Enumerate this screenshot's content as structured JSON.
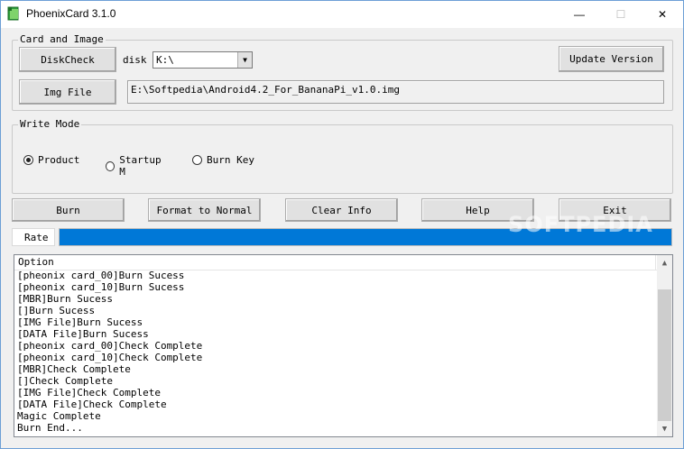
{
  "window": {
    "title": "PhoenixCard 3.1.0",
    "minimize_glyph": "—",
    "maximize_glyph": "☐",
    "close_glyph": "✕"
  },
  "card_image": {
    "group_label": "Card and Image",
    "diskcheck_label": "DiskCheck",
    "disk_label": "disk",
    "disk_value": "K:\\",
    "update_label": "Update Version",
    "imgfile_label": "Img File",
    "img_path": "E:\\Softpedia\\Android4.2_For_BananaPi_v1.0.img"
  },
  "write_mode": {
    "group_label": "Write Mode",
    "options": [
      {
        "label": "Product",
        "selected": true
      },
      {
        "label": "Startup M",
        "selected": false
      },
      {
        "label": "Burn Key",
        "selected": false
      }
    ]
  },
  "actions": {
    "burn": "Burn",
    "format": "Format to Normal",
    "clear": "Clear Info",
    "help": "Help",
    "exit": "Exit"
  },
  "rate": {
    "label": "Rate",
    "progress": 1.0,
    "color": "#0078d7"
  },
  "watermark": "SOFTPEDIA",
  "log": {
    "header": "Option",
    "rows": [
      "[pheonix card_00]Burn Sucess",
      "[pheonix card_10]Burn Sucess",
      "[MBR]Burn Sucess",
      "[]Burn Sucess",
      "[IMG File]Burn Sucess",
      "[DATA File]Burn Sucess",
      "[pheonix card_00]Check Complete",
      "[pheonix card_10]Check Complete",
      "[MBR]Check Complete",
      "[]Check Complete",
      "[IMG File]Check Complete",
      "[DATA File]Check Complete",
      "Magic Complete",
      "Burn End..."
    ]
  }
}
